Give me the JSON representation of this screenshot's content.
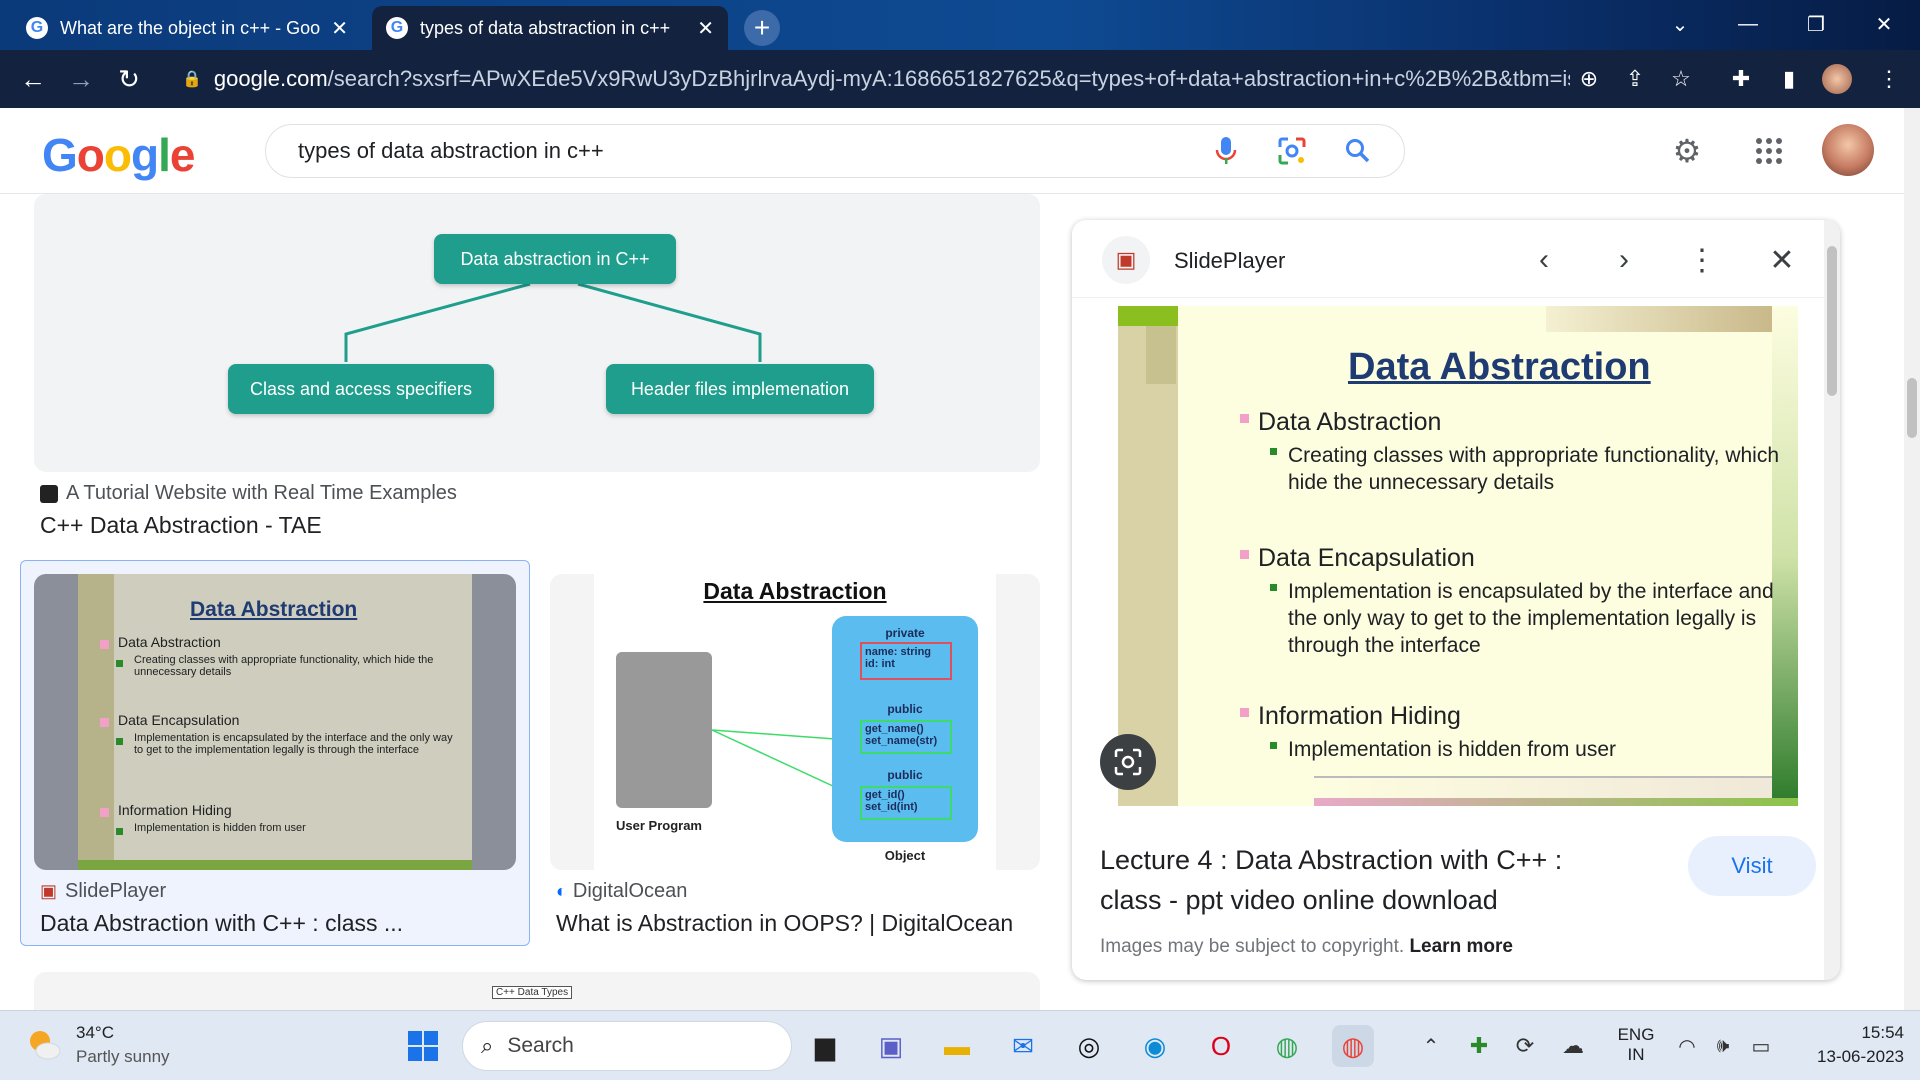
{
  "browser": {
    "tabs": [
      {
        "title": "What are the object in c++ - Goo",
        "active": false
      },
      {
        "title": "types of data abstraction in c++",
        "active": true
      }
    ],
    "url_host": "google.com",
    "url_rest": "/search?sxsrf=APwXEde5Vx9RwU3yDzBhjrlrvaAydj-myA:1686651827625&q=types+of+data+abstraction+in+c%2B%2B&tbm=isch..."
  },
  "google": {
    "logo": "Google",
    "query": "types of data abstraction in c++"
  },
  "results": [
    {
      "source": "A Tutorial Website with Real Time Examples",
      "title": "C++ Data Abstraction - TAE",
      "diagram": {
        "root": "Data abstraction in C++",
        "left": "Class and access specifiers",
        "right": "Header files implemenation"
      }
    },
    {
      "source": "SlidePlayer",
      "title": "Data Abstraction with C++ : class ...",
      "selected": true
    },
    {
      "source": "DigitalOcean",
      "title": "What is Abstraction in OOPS? | DigitalOcean",
      "image": {
        "heading": "Data Abstraction",
        "private_label": "private",
        "private_fields": "name: string\nid: int",
        "public_label_1": "public",
        "public_methods_1": "get_name()\nset_name(str)",
        "public_label_2": "public",
        "public_methods_2": "get_id()\nset_id(int)",
        "user_program": "User Program",
        "object": "Object"
      }
    },
    {
      "peek_label": "C++ Data Types"
    }
  ],
  "slide": {
    "title": "Data Abstraction",
    "b1": "Data Abstraction",
    "b1s": "Creating classes with appropriate functionality, which hide the unnecessary details",
    "b2": "Data Encapsulation",
    "b2s": "Implementation is encapsulated by the interface and the only way to get to the implementation legally is through the interface",
    "b3": "Information Hiding",
    "b3s": "Implementation is hidden from user"
  },
  "panel": {
    "source": "SlidePlayer",
    "title_line1": "Lecture 4 : Data Abstraction with C++ :",
    "title_line2": "class - ppt video online download",
    "visit": "Visit",
    "copyright": "Images may be subject to copyright.",
    "learn_more": "Learn more"
  },
  "taskbar": {
    "temp": "34°C",
    "weather": "Partly sunny",
    "search": "Search",
    "lang1": "ENG",
    "lang2": "IN",
    "time": "15:54",
    "date": "13-06-2023"
  },
  "colors": {
    "accent_teal": "#1f9e8d",
    "link_blue": "#1a73e8",
    "selected_border": "#8ab4f8"
  }
}
